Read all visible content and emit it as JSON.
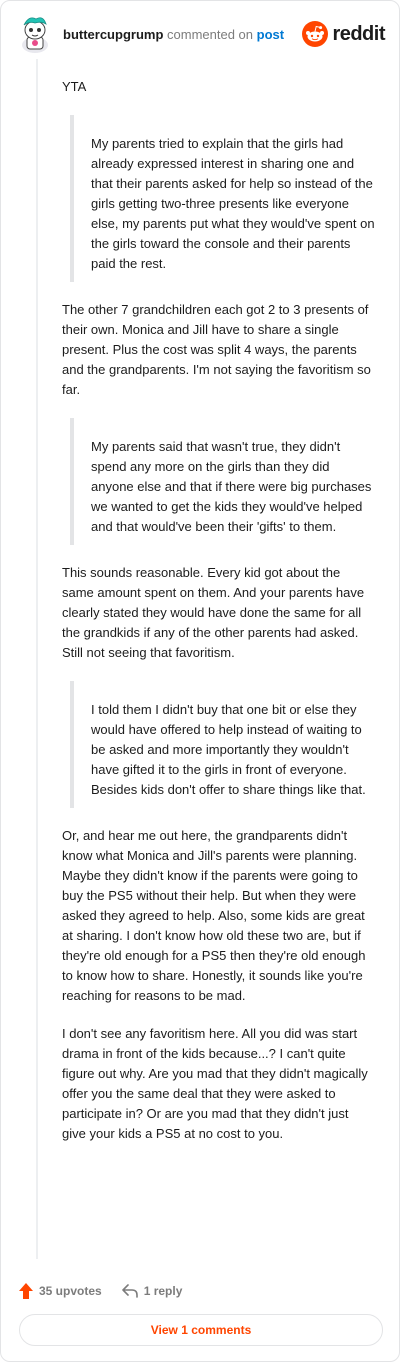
{
  "header": {
    "username": "buttercupgrump",
    "commented_on": "commented on",
    "post_link": "post",
    "brand_text": "reddit"
  },
  "comment": {
    "intro": "YTA",
    "quote1": "My parents tried to explain that the girls had already expressed interest in sharing one and that their parents asked for help so instead of the girls getting two-three presents like everyone else, my parents put what they would've spent on the girls toward the console and their parents paid the rest.",
    "para1": "The other 7 grandchildren each got 2 to 3 presents of their own. Monica and Jill have to share a single present. Plus the cost was split 4 ways, the parents and the grandparents. I'm not saying the favoritism so far.",
    "quote2": "My parents said that wasn't true, they didn't spend any more on the girls than they did anyone else and that if there were big purchases we wanted to get the kids they would've helped and that would've been their 'gifts' to them.",
    "para2": "This sounds reasonable. Every kid got about the same amount spent on them. And your parents have clearly stated they would have done the same for all the grandkids if any of the other parents had asked. Still not seeing that favoritism.",
    "quote3": "I told them I didn't buy that one bit or else they would have offered to help instead of waiting to be asked and more importantly they wouldn't have gifted it to the girls in front of everyone. Besides kids don't offer to share things like that.",
    "para3": "Or, and hear me out here, the grandparents didn't know what Monica and Jill's parents were planning. Maybe they didn't know if the parents were going to buy the PS5 without their help. But when they were asked they agreed to help. Also, some kids are great at sharing. I don't know how old these two are, but if they're old enough for a PS5 then they're old enough to know how to share. Honestly, it sounds like you're reaching for reasons to be mad.",
    "para4": "I don't see any favoritism here. All you did was start drama in front of the kids because...? I can't quite figure out why. Are you mad that they didn't magically offer you the same deal that they were asked to participate in? Or are you mad that they didn't just give your kids a PS5 at no cost to you."
  },
  "footer": {
    "upvotes": "35 upvotes",
    "replies": "1 reply",
    "view_comments": "View 1 comments"
  },
  "colors": {
    "upvote": "#ff4500",
    "link": "#0079d3",
    "muted": "#7c7c7c"
  },
  "icons": [
    "avatar",
    "reddit-logo-icon",
    "upvote-arrow-icon",
    "reply-icon"
  ]
}
